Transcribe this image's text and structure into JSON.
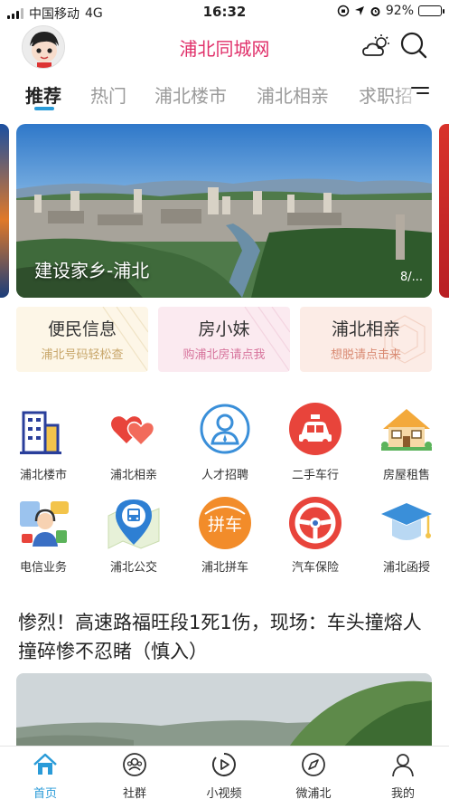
{
  "status_bar": {
    "carrier": "中国移动",
    "network": "4G",
    "time": "16:32",
    "battery": "92%",
    "battery_level": 0.92
  },
  "header": {
    "site_title": "浦北同城网"
  },
  "tabs": [
    {
      "label": "推荐",
      "active": true
    },
    {
      "label": "热门",
      "active": false
    },
    {
      "label": "浦北楼市",
      "active": false
    },
    {
      "label": "浦北相亲",
      "active": false
    },
    {
      "label": "求职招",
      "active": false
    }
  ],
  "banner": {
    "caption": "建设家乡-浦北",
    "counter": "8/..."
  },
  "promos": [
    {
      "title": "便民信息",
      "subtitle": "浦北号码轻松查",
      "bg": "#fdf6e7",
      "sub_color": "#c8a66a"
    },
    {
      "title": "房小妹",
      "subtitle": "购浦北房请点我",
      "bg": "#fbeaf0",
      "sub_color": "#d7749c"
    },
    {
      "title": "浦北相亲",
      "subtitle": "想脱请点击来",
      "bg": "#fcece6",
      "sub_color": "#d98a72"
    }
  ],
  "grid": [
    {
      "label": "浦北楼市",
      "icon": "building-icon"
    },
    {
      "label": "浦北相亲",
      "icon": "hearts-icon"
    },
    {
      "label": "人才招聘",
      "icon": "recruit-person-icon"
    },
    {
      "label": "二手车行",
      "icon": "taxi-icon"
    },
    {
      "label": "房屋租售",
      "icon": "house-icon"
    },
    {
      "label": "电信业务",
      "icon": "telecom-icon"
    },
    {
      "label": "浦北公交",
      "icon": "bus-map-icon"
    },
    {
      "label": "浦北拼车",
      "icon": "carpool-icon",
      "icon_text": "拼车"
    },
    {
      "label": "汽车保险",
      "icon": "steering-wheel-icon"
    },
    {
      "label": "浦北函授",
      "icon": "graduation-cap-icon"
    }
  ],
  "news": {
    "title": "惨烈！高速路福旺段1死1伤，现场：车头撞熔人撞碎惨不忍睹（慎入）"
  },
  "bottom_nav": [
    {
      "label": "首页",
      "icon": "home-icon",
      "active": true
    },
    {
      "label": "社群",
      "icon": "community-icon",
      "active": false
    },
    {
      "label": "小视频",
      "icon": "video-play-icon",
      "active": false
    },
    {
      "label": "微浦北",
      "icon": "compass-icon",
      "active": false
    },
    {
      "label": "我的",
      "icon": "profile-icon",
      "active": false
    }
  ],
  "colors": {
    "accent": "#2a9bd8",
    "title_pink": "#e0306a"
  }
}
